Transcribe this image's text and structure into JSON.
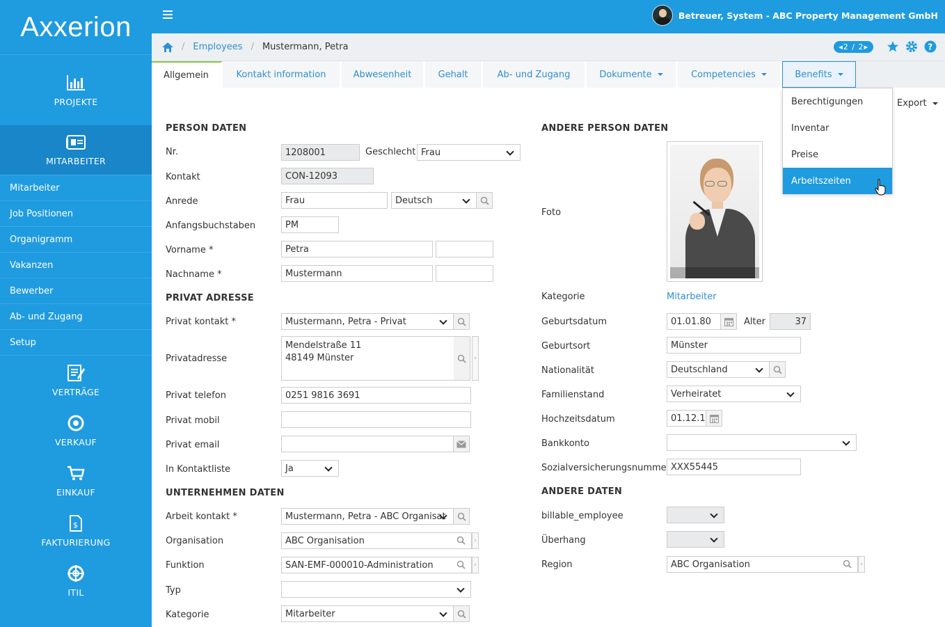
{
  "app": {
    "logo": "Axxerion",
    "user": "Betreuer, System - ABC Property Management GmbH"
  },
  "sidebar": {
    "projekte": "PROJEKTE",
    "mitarbeiter": "MITARBEITER",
    "sub": [
      "Mitarbeiter",
      "Job Positionen",
      "Organigramm",
      "Vakanzen",
      "Bewerber",
      "Ab- und Zugang",
      "Setup"
    ],
    "vertraege": "VERTRÄGE",
    "verkauf": "VERKAUF",
    "einkauf": "EINKAUF",
    "fakturierung": "FAKTURIERUNG",
    "itil": "ITIL"
  },
  "breadcrumb": {
    "link": "Employees",
    "current": "Mustermann, Petra",
    "pager": "2 / 2"
  },
  "tabs": [
    "Allgemein",
    "Kontakt information",
    "Abwesenheit",
    "Gehalt",
    "Ab- und Zugang",
    "Dokumente",
    "Competencies",
    "Benefits"
  ],
  "benefits_menu": [
    "Berechtigungen",
    "Inventar",
    "Preise",
    "Arbeitszeiten"
  ],
  "export": "Export",
  "person": {
    "heading": "PERSON DATEN",
    "nr_label": "Nr.",
    "nr": "1208001",
    "geschlecht_label": "Geschlecht",
    "geschlecht": "Frau",
    "kontakt_label": "Kontakt",
    "kontakt": "CON-12093",
    "anrede_label": "Anrede",
    "anrede": "Frau",
    "sprache": "Deutsch",
    "initials_label": "Anfangsbuchstaben",
    "initials": "PM",
    "vorname_label": "Vorname *",
    "vorname": "Petra",
    "nachname_label": "Nachname *",
    "nachname": "Mustermann"
  },
  "privat": {
    "heading": "PRIVAT ADRESSE",
    "kontakt_label": "Privat kontakt *",
    "kontakt": "Mustermann, Petra - Privat",
    "adresse_label": "Privatadresse",
    "adresse_line1": "Mendelstraße 11",
    "adresse_line2": "48149 Münster",
    "telefon_label": "Privat telefon",
    "telefon": "0251 9816 3691",
    "mobil_label": "Privat mobil",
    "email_label": "Privat email",
    "kontaktliste_label": "In Kontaktliste",
    "kontaktliste": "Ja"
  },
  "unternehmen": {
    "heading": "UNTERNEHMEN DATEN",
    "arbeit_label": "Arbeit kontakt *",
    "arbeit": "Mustermann, Petra - ABC Organisat",
    "org_label": "Organisation",
    "org": "ABC Organisation",
    "funktion_label": "Funktion",
    "funktion": "SAN-EMF-000010-Administration",
    "typ_label": "Typ",
    "kategorie_label": "Kategorie",
    "kategorie": "Mitarbeiter"
  },
  "andere": {
    "heading": "ANDERE PERSON DATEN",
    "foto_label": "Foto",
    "kategorie_label": "Kategorie",
    "kategorie": "Mitarbeiter",
    "geburtsdatum_label": "Geburtsdatum",
    "geburtsdatum": "01.01.80",
    "alter_label": "Alter",
    "alter": "37",
    "geburtsort_label": "Geburtsort",
    "geburtsort": "Münster",
    "nationalitaet_label": "Nationalität",
    "nationalitaet": "Deutschland",
    "familienstand_label": "Familienstand",
    "familienstand": "Verheiratet",
    "hochzeit_label": "Hochzeitsdatum",
    "hochzeit": "01.12.1",
    "bank_label": "Bankkonto",
    "svn_label": "Sozialversicherungsnummer",
    "svn": "XXX55445"
  },
  "andere_daten": {
    "heading": "ANDERE DATEN",
    "billable_label": "billable_employee",
    "ueberhang_label": "Überhang",
    "region_label": "Region",
    "region": "ABC Organisation"
  }
}
